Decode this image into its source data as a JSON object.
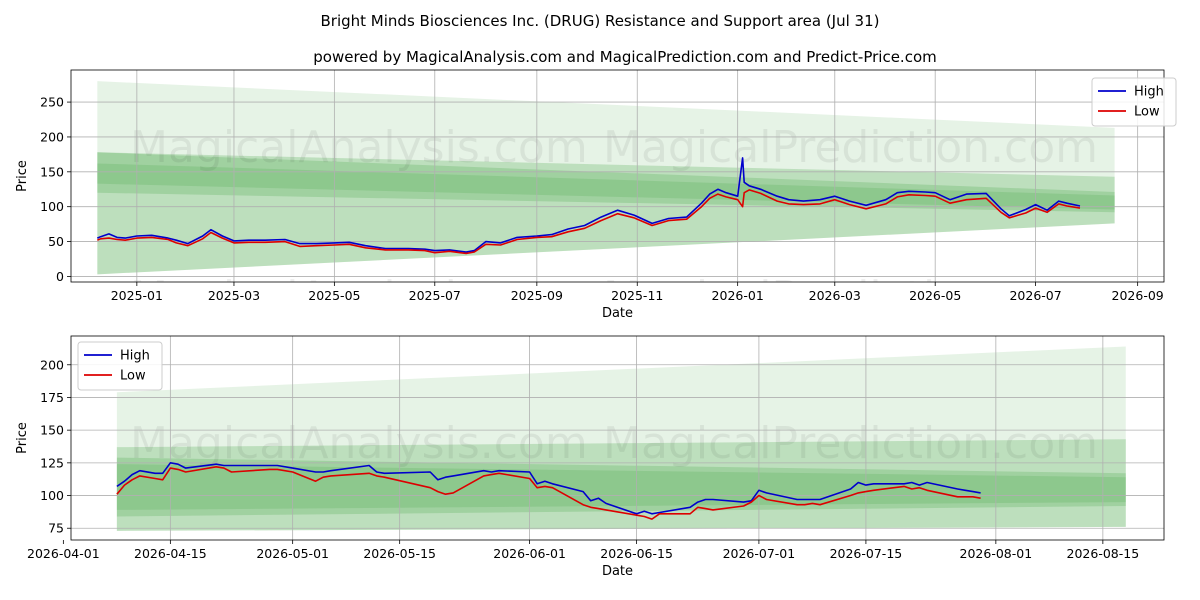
{
  "title": "Bright Minds Biosciences Inc. (DRUG) Resistance and Support area (Jul 31)",
  "subtitle": "powered by MagicalAnalysis.com and MagicalPrediction.com and Predict-Price.com",
  "watermarks": [
    "MagicalAnalysis.com",
    "MagicalPrediction.com"
  ],
  "colors": {
    "high": "#0000cc",
    "low": "#dd0000",
    "band": "#2e9a2e",
    "grid": "#b0b0b0"
  },
  "chart_data": [
    {
      "type": "line",
      "xlabel": "Date",
      "ylabel": "Price",
      "x_axis": "date",
      "xlim": [
        "2024-11-22",
        "2026-09-17"
      ],
      "ylim": [
        -8,
        296
      ],
      "x_ticks": [
        "2025-01-01",
        "2025-03-01",
        "2025-05-01",
        "2025-07-01",
        "2025-09-01",
        "2025-11-01",
        "2026-01-01",
        "2026-03-01",
        "2026-05-01",
        "2026-07-01",
        "2026-09-01"
      ],
      "x_tick_labels": [
        "2025-01",
        "2025-03",
        "2025-05",
        "2025-07",
        "2025-09",
        "2025-11",
        "2026-01",
        "2026-03",
        "2026-05",
        "2026-07",
        "2026-09"
      ],
      "y_ticks": [
        0,
        50,
        100,
        150,
        200,
        250
      ],
      "grid": true,
      "legend": {
        "placement": "top-right",
        "entries": [
          "High",
          "Low"
        ]
      },
      "bands": [
        {
          "x": [
            "2024-12-08",
            "2026-08-18"
          ],
          "upper": [
            280,
            213
          ],
          "lower": [
            3,
            76
          ],
          "opacity": 0.12
        },
        {
          "x": [
            "2024-12-08",
            "2026-08-18"
          ],
          "upper": [
            178,
            143
          ],
          "lower": [
            3,
            76
          ],
          "opacity": 0.22
        },
        {
          "x": [
            "2024-12-08",
            "2026-08-18"
          ],
          "upper": [
            178,
            121
          ],
          "lower": [
            120,
            92
          ],
          "opacity": 0.2
        },
        {
          "x": [
            "2024-12-08",
            "2026-08-18"
          ],
          "upper": [
            162,
            116
          ],
          "lower": [
            133,
            96
          ],
          "opacity": 0.16
        }
      ],
      "series": [
        {
          "name": "High",
          "x": [
            "2024-12-08",
            "2024-12-10",
            "2024-12-15",
            "2024-12-20",
            "2024-12-25",
            "2025-01-01",
            "2025-01-10",
            "2025-01-20",
            "2025-01-25",
            "2025-02-01",
            "2025-02-10",
            "2025-02-15",
            "2025-02-22",
            "2025-03-01",
            "2025-03-10",
            "2025-03-20",
            "2025-04-01",
            "2025-04-10",
            "2025-04-20",
            "2025-05-01",
            "2025-05-10",
            "2025-05-20",
            "2025-06-01",
            "2025-06-15",
            "2025-06-25",
            "2025-07-01",
            "2025-07-10",
            "2025-07-20",
            "2025-07-25",
            "2025-08-01",
            "2025-08-10",
            "2025-08-20",
            "2025-09-01",
            "2025-09-10",
            "2025-09-20",
            "2025-09-30",
            "2025-10-10",
            "2025-10-20",
            "2025-10-30",
            "2025-11-10",
            "2025-11-20",
            "2025-12-01",
            "2025-12-10",
            "2025-12-15",
            "2025-12-20",
            "2025-12-25",
            "2026-01-01",
            "2026-01-04",
            "2026-01-05",
            "2026-01-08",
            "2026-01-15",
            "2026-01-25",
            "2026-02-01",
            "2026-02-10",
            "2026-02-20",
            "2026-03-01",
            "2026-03-10",
            "2026-03-20",
            "2026-04-01",
            "2026-04-08",
            "2026-04-15",
            "2026-04-25",
            "2026-05-01",
            "2026-05-10",
            "2026-05-20",
            "2026-06-01",
            "2026-06-10",
            "2026-06-15",
            "2026-06-25",
            "2026-07-01",
            "2026-07-08",
            "2026-07-15",
            "2026-07-20",
            "2026-07-28"
          ],
          "y": [
            55,
            57,
            61,
            56,
            55,
            58,
            59,
            55,
            52,
            47,
            58,
            67,
            58,
            51,
            52,
            52,
            53,
            47,
            47,
            48,
            49,
            44,
            40,
            40,
            39,
            37,
            38,
            35,
            37,
            50,
            48,
            56,
            58,
            60,
            68,
            73,
            85,
            95,
            88,
            76,
            83,
            85,
            105,
            118,
            125,
            120,
            115,
            170,
            135,
            130,
            125,
            115,
            110,
            108,
            110,
            115,
            108,
            102,
            110,
            120,
            122,
            121,
            120,
            110,
            118,
            119,
            97,
            87,
            96,
            103,
            95,
            108,
            105,
            101
          ]
        },
        {
          "name": "Low",
          "x": [
            "2024-12-08",
            "2024-12-10",
            "2024-12-15",
            "2024-12-20",
            "2024-12-25",
            "2025-01-01",
            "2025-01-10",
            "2025-01-20",
            "2025-01-25",
            "2025-02-01",
            "2025-02-10",
            "2025-02-15",
            "2025-02-22",
            "2025-03-01",
            "2025-03-10",
            "2025-03-20",
            "2025-04-01",
            "2025-04-10",
            "2025-04-20",
            "2025-05-01",
            "2025-05-10",
            "2025-05-20",
            "2025-06-01",
            "2025-06-15",
            "2025-06-25",
            "2025-07-01",
            "2025-07-10",
            "2025-07-20",
            "2025-07-25",
            "2025-08-01",
            "2025-08-10",
            "2025-08-20",
            "2025-09-01",
            "2025-09-10",
            "2025-09-20",
            "2025-09-30",
            "2025-10-10",
            "2025-10-20",
            "2025-10-30",
            "2025-11-10",
            "2025-11-20",
            "2025-12-01",
            "2025-12-10",
            "2025-12-15",
            "2025-12-20",
            "2025-12-25",
            "2026-01-01",
            "2026-01-04",
            "2026-01-05",
            "2026-01-08",
            "2026-01-15",
            "2026-01-25",
            "2026-02-01",
            "2026-02-10",
            "2026-02-20",
            "2026-03-01",
            "2026-03-10",
            "2026-03-20",
            "2026-04-01",
            "2026-04-08",
            "2026-04-15",
            "2026-04-25",
            "2026-05-01",
            "2026-05-10",
            "2026-05-20",
            "2026-06-01",
            "2026-06-10",
            "2026-06-15",
            "2026-06-25",
            "2026-07-01",
            "2026-07-08",
            "2026-07-15",
            "2026-07-20",
            "2026-07-28"
          ],
          "y": [
            52,
            54,
            55,
            53,
            52,
            55,
            56,
            53,
            48,
            44,
            54,
            63,
            55,
            48,
            49,
            49,
            50,
            43,
            44,
            45,
            46,
            41,
            38,
            38,
            37,
            34,
            36,
            33,
            35,
            46,
            45,
            53,
            56,
            57,
            64,
            69,
            80,
            90,
            84,
            73,
            80,
            82,
            100,
            112,
            118,
            114,
            110,
            100,
            120,
            124,
            119,
            108,
            104,
            103,
            104,
            110,
            103,
            97,
            104,
            114,
            117,
            116,
            115,
            105,
            110,
            112,
            92,
            84,
            91,
            98,
            92,
            104,
            101,
            98
          ]
        }
      ]
    },
    {
      "type": "line",
      "xlabel": "Date",
      "ylabel": "Price",
      "x_axis": "date",
      "xlim": [
        "2026-04-02",
        "2026-08-23"
      ],
      "ylim": [
        66,
        222
      ],
      "x_ticks": [
        "2026-04-01",
        "2026-04-15",
        "2026-05-01",
        "2026-05-15",
        "2026-06-01",
        "2026-06-15",
        "2026-07-01",
        "2026-07-15",
        "2026-08-01",
        "2026-08-15"
      ],
      "x_tick_labels": [
        "2026-04-01",
        "2026-04-15",
        "2026-05-01",
        "2026-05-15",
        "2026-06-01",
        "2026-06-15",
        "2026-07-01",
        "2026-07-15",
        "2026-08-01",
        "2026-08-15"
      ],
      "y_ticks": [
        75,
        100,
        125,
        150,
        175,
        200
      ],
      "grid": true,
      "legend": {
        "placement": "top-left",
        "entries": [
          "High",
          "Low"
        ]
      },
      "bands": [
        {
          "x": [
            "2026-04-08",
            "2026-08-18"
          ],
          "upper": [
            179,
            214
          ],
          "lower": [
            73,
            76
          ],
          "opacity": 0.12
        },
        {
          "x": [
            "2026-04-08",
            "2026-08-18"
          ],
          "upper": [
            137,
            143
          ],
          "lower": [
            73,
            76
          ],
          "opacity": 0.22
        },
        {
          "x": [
            "2026-04-08",
            "2026-08-18"
          ],
          "upper": [
            129,
            117
          ],
          "lower": [
            84,
            92
          ],
          "opacity": 0.2
        },
        {
          "x": [
            "2026-04-08",
            "2026-08-18"
          ],
          "upper": [
            124,
            114
          ],
          "lower": [
            89,
            95
          ],
          "opacity": 0.16
        }
      ],
      "series": [
        {
          "name": "High",
          "x": [
            "2026-04-08",
            "2026-04-09",
            "2026-04-10",
            "2026-04-11",
            "2026-04-13",
            "2026-04-14",
            "2026-04-15",
            "2026-04-16",
            "2026-04-17",
            "2026-04-21",
            "2026-04-22",
            "2026-04-23",
            "2026-04-28",
            "2026-04-29",
            "2026-05-01",
            "2026-05-04",
            "2026-05-05",
            "2026-05-06",
            "2026-05-11",
            "2026-05-12",
            "2026-05-13",
            "2026-05-19",
            "2026-05-20",
            "2026-05-21",
            "2026-05-22",
            "2026-05-26",
            "2026-05-27",
            "2026-05-28",
            "2026-06-01",
            "2026-06-02",
            "2026-06-03",
            "2026-06-04",
            "2026-06-08",
            "2026-06-09",
            "2026-06-10",
            "2026-06-11",
            "2026-06-15",
            "2026-06-16",
            "2026-06-17",
            "2026-06-18",
            "2026-06-22",
            "2026-06-23",
            "2026-06-24",
            "2026-06-25",
            "2026-06-29",
            "2026-06-30",
            "2026-07-01",
            "2026-07-02",
            "2026-07-06",
            "2026-07-07",
            "2026-07-08",
            "2026-07-09",
            "2026-07-13",
            "2026-07-14",
            "2026-07-15",
            "2026-07-16",
            "2026-07-20",
            "2026-07-21",
            "2026-07-22",
            "2026-07-23",
            "2026-07-27",
            "2026-07-28",
            "2026-07-29",
            "2026-07-30"
          ],
          "y": [
            107,
            111,
            116,
            119,
            117,
            117,
            125,
            124,
            121,
            124,
            123,
            123,
            123,
            123,
            121,
            118,
            118,
            119,
            123,
            118,
            117,
            118,
            112,
            114,
            115,
            119,
            118,
            119,
            118,
            109,
            111,
            109,
            103,
            96,
            98,
            94,
            86,
            88,
            86,
            87,
            91,
            95,
            97,
            97,
            95,
            96,
            104,
            102,
            97,
            97,
            97,
            97,
            105,
            110,
            108,
            109,
            109,
            110,
            108,
            110,
            105,
            104,
            103,
            102
          ]
        },
        {
          "name": "Low",
          "x": [
            "2026-04-08",
            "2026-04-09",
            "2026-04-10",
            "2026-04-11",
            "2026-04-13",
            "2026-04-14",
            "2026-04-15",
            "2026-04-16",
            "2026-04-17",
            "2026-04-21",
            "2026-04-22",
            "2026-04-23",
            "2026-04-28",
            "2026-04-29",
            "2026-05-01",
            "2026-05-04",
            "2026-05-05",
            "2026-05-06",
            "2026-05-11",
            "2026-05-12",
            "2026-05-13",
            "2026-05-19",
            "2026-05-20",
            "2026-05-21",
            "2026-05-22",
            "2026-05-26",
            "2026-05-27",
            "2026-05-28",
            "2026-06-01",
            "2026-06-02",
            "2026-06-03",
            "2026-06-04",
            "2026-06-08",
            "2026-06-09",
            "2026-06-10",
            "2026-06-11",
            "2026-06-15",
            "2026-06-16",
            "2026-06-17",
            "2026-06-18",
            "2026-06-22",
            "2026-06-23",
            "2026-06-24",
            "2026-06-25",
            "2026-06-29",
            "2026-06-30",
            "2026-07-01",
            "2026-07-02",
            "2026-07-06",
            "2026-07-07",
            "2026-07-08",
            "2026-07-09",
            "2026-07-13",
            "2026-07-14",
            "2026-07-15",
            "2026-07-16",
            "2026-07-20",
            "2026-07-21",
            "2026-07-22",
            "2026-07-23",
            "2026-07-27",
            "2026-07-28",
            "2026-07-29",
            "2026-07-30"
          ],
          "y": [
            101,
            108,
            112,
            115,
            113,
            112,
            121,
            120,
            118,
            122,
            121,
            118,
            120,
            120,
            118,
            111,
            114,
            115,
            117,
            115,
            114,
            106,
            103,
            101,
            102,
            115,
            116,
            117,
            113,
            106,
            107,
            106,
            93,
            91,
            90,
            89,
            85,
            84,
            82,
            86,
            86,
            91,
            90,
            89,
            92,
            95,
            100,
            97,
            93,
            93,
            94,
            93,
            100,
            102,
            103,
            104,
            107,
            105,
            106,
            104,
            99,
            99,
            99,
            98
          ]
        }
      ]
    }
  ]
}
